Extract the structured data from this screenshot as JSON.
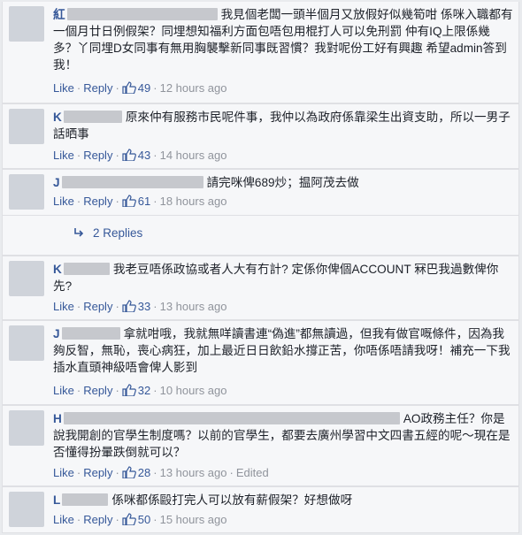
{
  "like_label": "Like",
  "reply_label": "Reply",
  "dot": "·",
  "comments": [
    {
      "initial": "紅",
      "text": "我見個老闆一頭半個月又放假好似幾筍咁 係咪入職都有一個月廿日例假架？同埋想知福利方面包唔包用棍打人可以免刑罰 仲有IQ上限係幾多？丫同埋D女同事有無用胸襲擊新同事既習慣？我對呢份工好有興趣 希望admin答到我！",
      "likes": "49",
      "time": "12 hours ago"
    },
    {
      "initial": "K",
      "text": "原來仲有服務市民呢件事，我仲以為政府係靠梁生出資支助，所以一男子話晒事",
      "likes": "43",
      "time": "14 hours ago"
    },
    {
      "initial": "J",
      "text": "請完咪俾689炒；揾阿茂去做",
      "likes": "61",
      "time": "18 hours ago"
    },
    {
      "initial": "K",
      "text": "我老豆唔係政協或者人大有冇計? 定係你俾個ACCOUNT 冧巴我過數俾你先?",
      "likes": "33",
      "time": "13 hours ago"
    },
    {
      "initial": "J",
      "text": "拿就咁哦，我就無咩讀書連“偽進”都無讀過，但我有做官嘅條件，因為我夠反智，無恥，喪心病狂，加上最近日日飲鉛水撐正苦，你唔係唔請我呀！補充一下我插水直頭神級唔會俾人影到",
      "likes": "32",
      "time": "10 hours ago"
    },
    {
      "initial": "H",
      "text": "AO政務主任？你是說我開創的官學生制度嗎？以前的官學生，都要去廣州學習中文四書五經的呢～現在是否懂得扮暈跌倒就可以？",
      "likes": "28",
      "time": "13 hours ago",
      "edited": "Edited"
    },
    {
      "initial": "L",
      "text": "係咪都係毆打完人可以放有薪假架？好想做呀",
      "likes": "50",
      "time": "15 hours ago"
    }
  ],
  "replies": {
    "label": "2 Replies"
  },
  "colors": {
    "link": "#365899",
    "meta": "#90949c",
    "background": "#f6f7f9"
  },
  "icons": {
    "like": "thumbs-up-icon",
    "reply_arrow": "reply-arrow-icon"
  }
}
